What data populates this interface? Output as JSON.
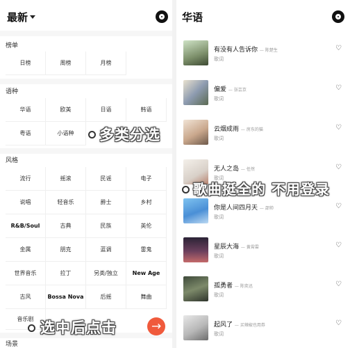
{
  "left": {
    "title": "最新",
    "sections": [
      {
        "title": "榜单",
        "items": [
          "日榜",
          "周榜",
          "月榜"
        ]
      },
      {
        "title": "语种",
        "items": [
          "华语",
          "欧美",
          "日语",
          "韩语",
          "粤语",
          "小语种"
        ]
      },
      {
        "title": "风格",
        "items": [
          "流行",
          "摇滚",
          "民谣",
          "电子",
          "说唱",
          "轻音乐",
          "爵士",
          "乡村",
          "R&B/Soul",
          "古典",
          "民族",
          "英伦",
          "金属",
          "朋克",
          "蓝调",
          "雷鬼",
          "世界音乐",
          "拉丁",
          "另类/独立",
          "New Age",
          "古风",
          "Bossa Nova",
          "后摇",
          "舞曲",
          "音乐剧"
        ]
      },
      {
        "title": "场景",
        "items": []
      }
    ],
    "overlay_text_1": "多类分选",
    "overlay_text_3": "选中后点击",
    "fab_icon": "arrow-right-icon"
  },
  "right": {
    "title": "华语",
    "songs": [
      {
        "title": "有没有人告诉你",
        "artist": "陈楚生",
        "sub": "歌词"
      },
      {
        "title": "偏爱",
        "artist": "张芸京",
        "sub": "歌词"
      },
      {
        "title": "云烟成雨",
        "artist": "房东的猫",
        "sub": "歌词"
      },
      {
        "title": "无人之岛",
        "artist": "任然",
        "sub": "歌词"
      },
      {
        "title": "你是人间四月天",
        "artist": "邵帅",
        "sub": "歌词"
      },
      {
        "title": "星辰大海",
        "artist": "黄霄雲",
        "sub": "歌词"
      },
      {
        "title": "孤勇者",
        "artist": "陈奕迅",
        "sub": "歌词"
      },
      {
        "title": "起风了",
        "artist": "买辣椒也用券",
        "sub": "歌词"
      }
    ],
    "overlay_text_2": "歌曲挺全的 不用登录"
  },
  "colors": {
    "accent": "#f05a3c",
    "section_bg": "#f6f6f6"
  },
  "icons": {
    "disc": "music-disc-icon",
    "heart": "heart-outline-icon",
    "caret": "caret-down-icon"
  }
}
